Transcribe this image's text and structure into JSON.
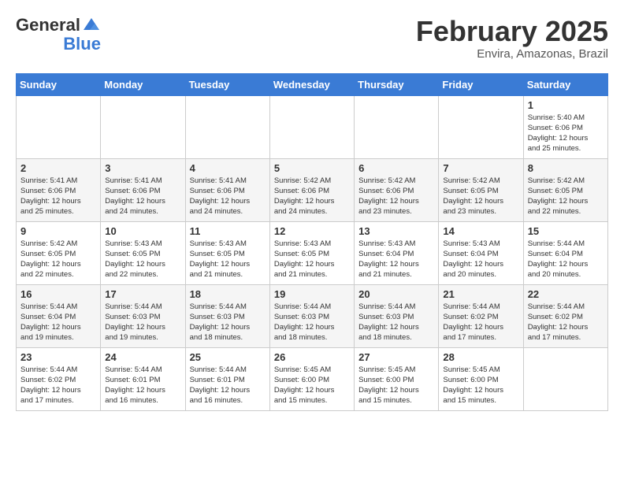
{
  "header": {
    "logo_general": "General",
    "logo_blue": "Blue",
    "month_title": "February 2025",
    "location": "Envira, Amazonas, Brazil"
  },
  "days_of_week": [
    "Sunday",
    "Monday",
    "Tuesday",
    "Wednesday",
    "Thursday",
    "Friday",
    "Saturday"
  ],
  "weeks": [
    [
      {
        "day": "",
        "info": ""
      },
      {
        "day": "",
        "info": ""
      },
      {
        "day": "",
        "info": ""
      },
      {
        "day": "",
        "info": ""
      },
      {
        "day": "",
        "info": ""
      },
      {
        "day": "",
        "info": ""
      },
      {
        "day": "1",
        "info": "Sunrise: 5:40 AM\nSunset: 6:06 PM\nDaylight: 12 hours\nand 25 minutes."
      }
    ],
    [
      {
        "day": "2",
        "info": "Sunrise: 5:41 AM\nSunset: 6:06 PM\nDaylight: 12 hours\nand 25 minutes."
      },
      {
        "day": "3",
        "info": "Sunrise: 5:41 AM\nSunset: 6:06 PM\nDaylight: 12 hours\nand 24 minutes."
      },
      {
        "day": "4",
        "info": "Sunrise: 5:41 AM\nSunset: 6:06 PM\nDaylight: 12 hours\nand 24 minutes."
      },
      {
        "day": "5",
        "info": "Sunrise: 5:42 AM\nSunset: 6:06 PM\nDaylight: 12 hours\nand 24 minutes."
      },
      {
        "day": "6",
        "info": "Sunrise: 5:42 AM\nSunset: 6:06 PM\nDaylight: 12 hours\nand 23 minutes."
      },
      {
        "day": "7",
        "info": "Sunrise: 5:42 AM\nSunset: 6:05 PM\nDaylight: 12 hours\nand 23 minutes."
      },
      {
        "day": "8",
        "info": "Sunrise: 5:42 AM\nSunset: 6:05 PM\nDaylight: 12 hours\nand 22 minutes."
      }
    ],
    [
      {
        "day": "9",
        "info": "Sunrise: 5:42 AM\nSunset: 6:05 PM\nDaylight: 12 hours\nand 22 minutes."
      },
      {
        "day": "10",
        "info": "Sunrise: 5:43 AM\nSunset: 6:05 PM\nDaylight: 12 hours\nand 22 minutes."
      },
      {
        "day": "11",
        "info": "Sunrise: 5:43 AM\nSunset: 6:05 PM\nDaylight: 12 hours\nand 21 minutes."
      },
      {
        "day": "12",
        "info": "Sunrise: 5:43 AM\nSunset: 6:05 PM\nDaylight: 12 hours\nand 21 minutes."
      },
      {
        "day": "13",
        "info": "Sunrise: 5:43 AM\nSunset: 6:04 PM\nDaylight: 12 hours\nand 21 minutes."
      },
      {
        "day": "14",
        "info": "Sunrise: 5:43 AM\nSunset: 6:04 PM\nDaylight: 12 hours\nand 20 minutes."
      },
      {
        "day": "15",
        "info": "Sunrise: 5:44 AM\nSunset: 6:04 PM\nDaylight: 12 hours\nand 20 minutes."
      }
    ],
    [
      {
        "day": "16",
        "info": "Sunrise: 5:44 AM\nSunset: 6:04 PM\nDaylight: 12 hours\nand 19 minutes."
      },
      {
        "day": "17",
        "info": "Sunrise: 5:44 AM\nSunset: 6:03 PM\nDaylight: 12 hours\nand 19 minutes."
      },
      {
        "day": "18",
        "info": "Sunrise: 5:44 AM\nSunset: 6:03 PM\nDaylight: 12 hours\nand 18 minutes."
      },
      {
        "day": "19",
        "info": "Sunrise: 5:44 AM\nSunset: 6:03 PM\nDaylight: 12 hours\nand 18 minutes."
      },
      {
        "day": "20",
        "info": "Sunrise: 5:44 AM\nSunset: 6:03 PM\nDaylight: 12 hours\nand 18 minutes."
      },
      {
        "day": "21",
        "info": "Sunrise: 5:44 AM\nSunset: 6:02 PM\nDaylight: 12 hours\nand 17 minutes."
      },
      {
        "day": "22",
        "info": "Sunrise: 5:44 AM\nSunset: 6:02 PM\nDaylight: 12 hours\nand 17 minutes."
      }
    ],
    [
      {
        "day": "23",
        "info": "Sunrise: 5:44 AM\nSunset: 6:02 PM\nDaylight: 12 hours\nand 17 minutes."
      },
      {
        "day": "24",
        "info": "Sunrise: 5:44 AM\nSunset: 6:01 PM\nDaylight: 12 hours\nand 16 minutes."
      },
      {
        "day": "25",
        "info": "Sunrise: 5:44 AM\nSunset: 6:01 PM\nDaylight: 12 hours\nand 16 minutes."
      },
      {
        "day": "26",
        "info": "Sunrise: 5:45 AM\nSunset: 6:00 PM\nDaylight: 12 hours\nand 15 minutes."
      },
      {
        "day": "27",
        "info": "Sunrise: 5:45 AM\nSunset: 6:00 PM\nDaylight: 12 hours\nand 15 minutes."
      },
      {
        "day": "28",
        "info": "Sunrise: 5:45 AM\nSunset: 6:00 PM\nDaylight: 12 hours\nand 15 minutes."
      },
      {
        "day": "",
        "info": ""
      }
    ]
  ]
}
